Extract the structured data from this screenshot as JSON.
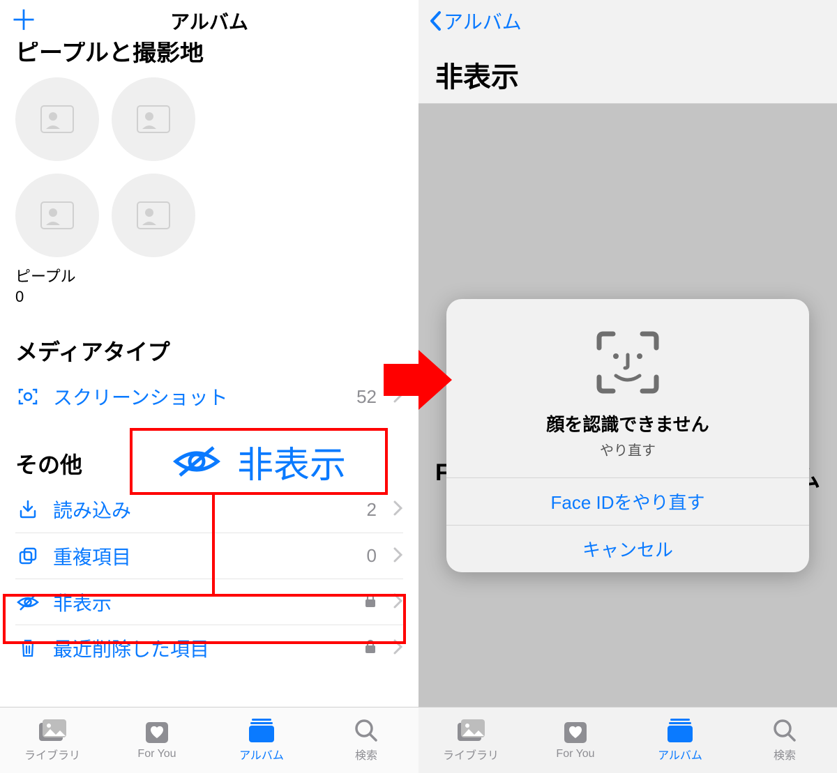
{
  "left": {
    "header_title": "アルバム",
    "people_header_clipped": "ピープルと撮影地",
    "people_label": "ピープル",
    "people_count": "0",
    "media_section_title": "メディアタイプ",
    "media_row": {
      "label": "スクリーンショット",
      "count": "52"
    },
    "other_section_title": "その他",
    "rows": [
      {
        "label": "読み込み",
        "count": "2"
      },
      {
        "label": "重複項目",
        "count": "0"
      },
      {
        "label": "非表示"
      },
      {
        "label": "最近削除した項目"
      }
    ],
    "callout_label": "非表示"
  },
  "right": {
    "back_label": "アルバム",
    "page_title": "非表示",
    "behind_left": "Fa",
    "behind_right": "ム",
    "modal": {
      "title": "顔を認識できません",
      "subtitle": "やり直す",
      "retry": "Face IDをやり直す",
      "cancel": "キャンセル"
    }
  },
  "tabs": [
    {
      "label": "ライブラリ"
    },
    {
      "label": "For You"
    },
    {
      "label": "アルバム"
    },
    {
      "label": "検索"
    }
  ]
}
